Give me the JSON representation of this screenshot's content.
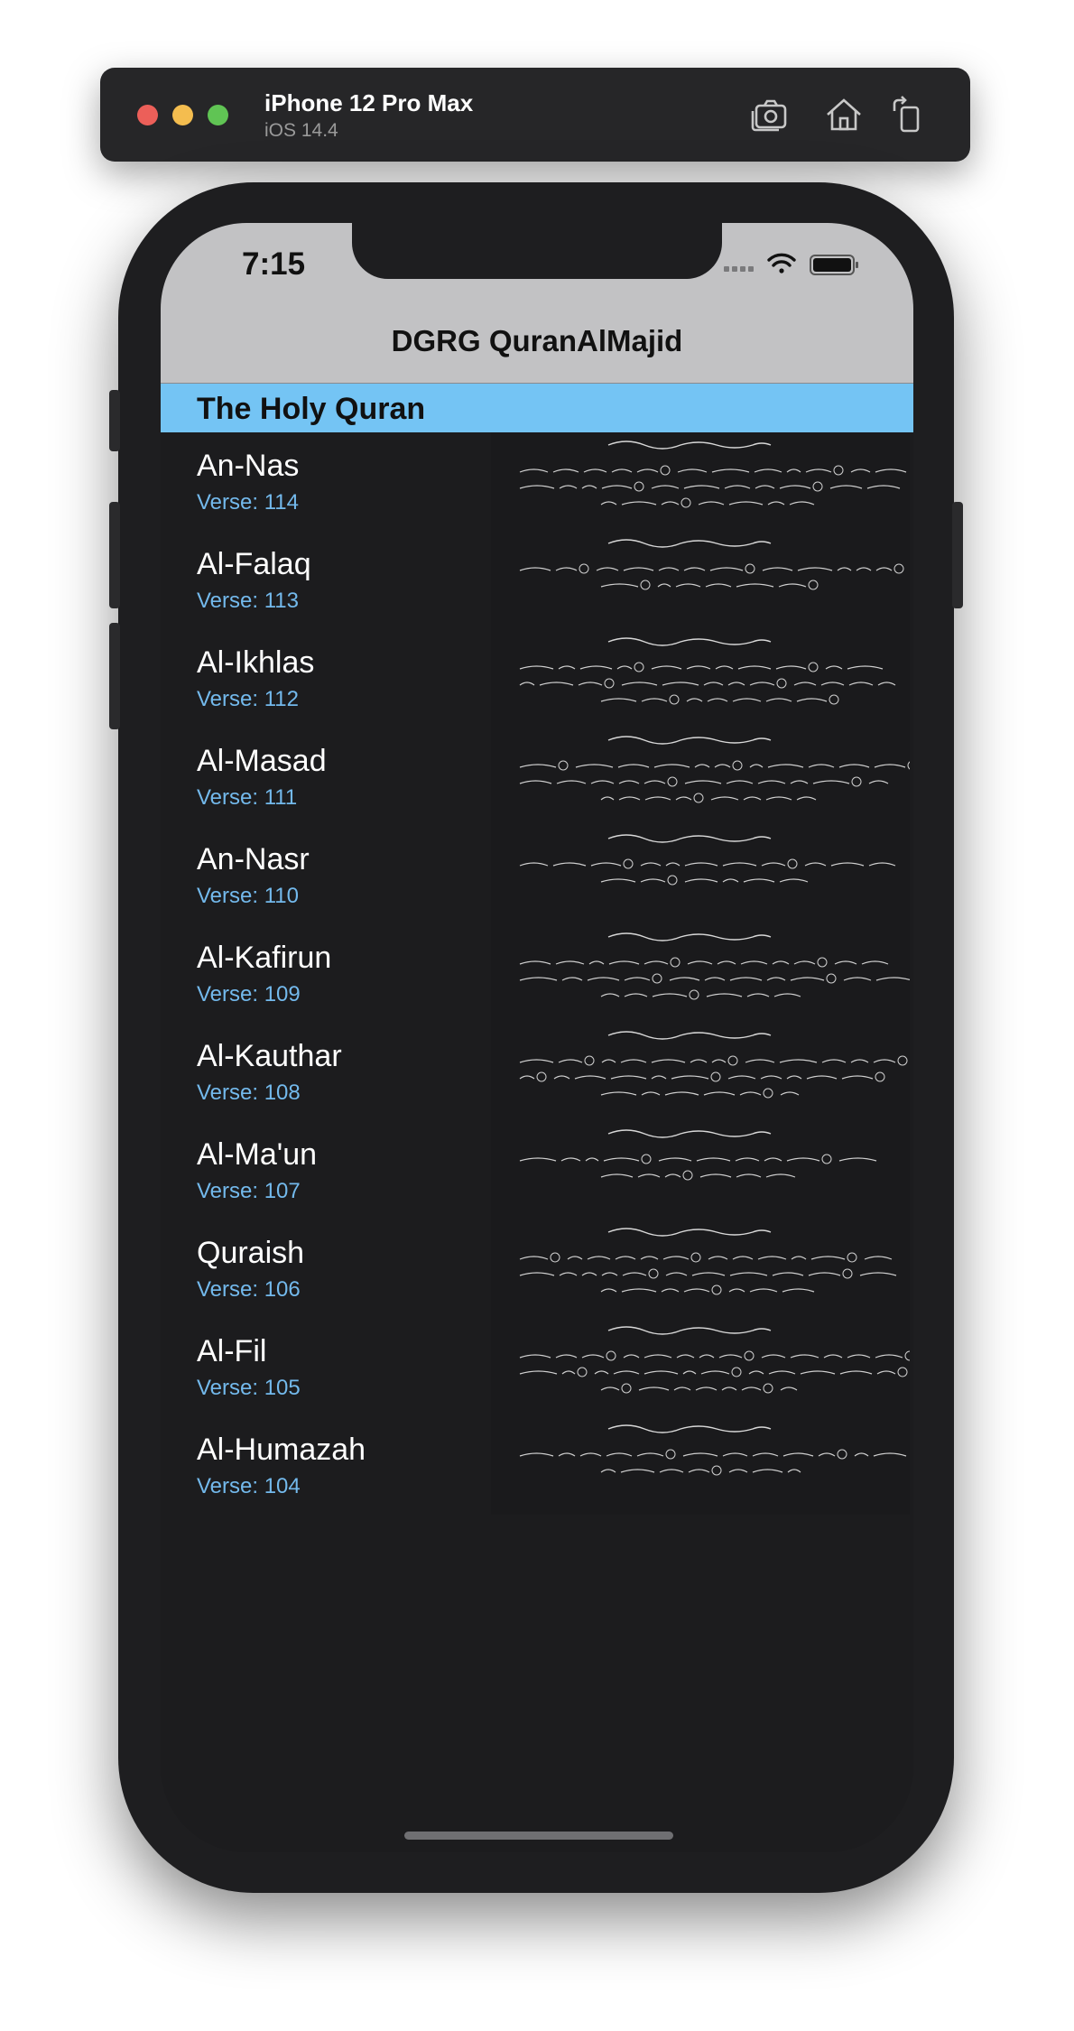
{
  "simulator": {
    "device_name": "iPhone 12 Pro Max",
    "os_version": "iOS 14.4",
    "icons": [
      "screenshot-icon",
      "home-icon",
      "rotate-icon"
    ]
  },
  "status_bar": {
    "time": "7:15"
  },
  "nav": {
    "title": "DGRG QuranAlMajid"
  },
  "section": {
    "header": "The Holy Quran"
  },
  "surahs": [
    {
      "name": "An-Nas",
      "verse": "Verse: 114"
    },
    {
      "name": "Al-Falaq",
      "verse": "Verse: 113"
    },
    {
      "name": "Al-Ikhlas",
      "verse": "Verse: 112"
    },
    {
      "name": "Al-Masad",
      "verse": "Verse: 111"
    },
    {
      "name": "An-Nasr",
      "verse": "Verse: 110"
    },
    {
      "name": "Al-Kafirun",
      "verse": "Verse: 109"
    },
    {
      "name": "Al-Kauthar",
      "verse": "Verse: 108"
    },
    {
      "name": "Al-Ma'un",
      "verse": "Verse: 107"
    },
    {
      "name": "Quraish",
      "verse": "Verse: 106"
    },
    {
      "name": "Al-Fil",
      "verse": "Verse: 105"
    },
    {
      "name": "Al-Humazah",
      "verse": "Verse: 104"
    }
  ],
  "colors": {
    "section_header_bg": "#74c4f4",
    "verse_text": "#73b9ec",
    "list_bg": "#1c1c1e",
    "nav_bg": "#c2c2c4"
  }
}
